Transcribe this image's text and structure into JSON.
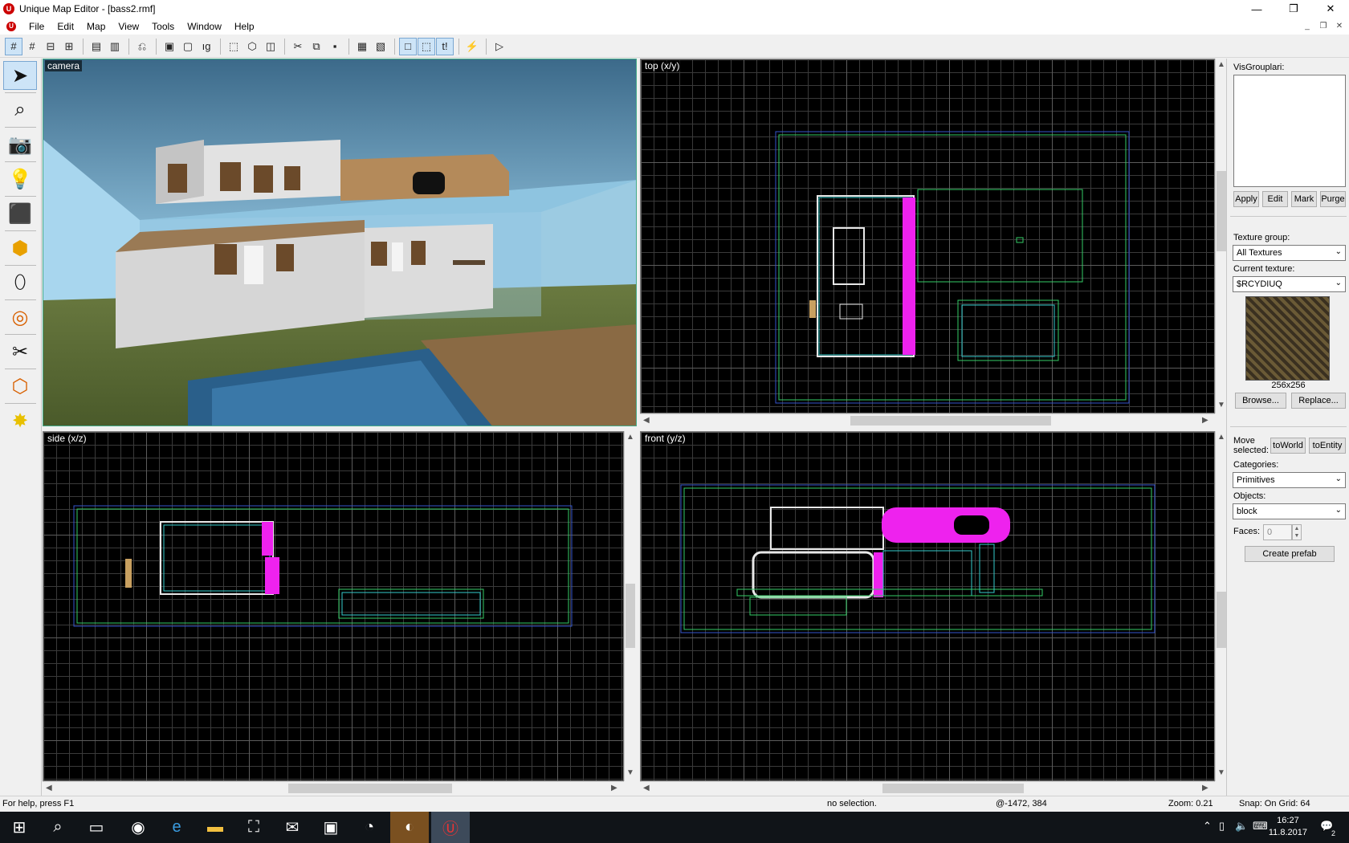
{
  "window": {
    "title": "Unique Map Editor - [bass2.rmf]",
    "minimize": "—",
    "maximize": "❐",
    "close": "✕"
  },
  "menu": [
    {
      "label": "File"
    },
    {
      "label": "Edit"
    },
    {
      "label": "Map"
    },
    {
      "label": "View"
    },
    {
      "label": "Tools"
    },
    {
      "label": "Window"
    },
    {
      "label": "Help"
    }
  ],
  "viewports": {
    "camera": "camera",
    "top": "top (x/y)",
    "side": "side (x/z)",
    "front": "front (y/z)"
  },
  "visgroups": {
    "title": "VisGrouplari:",
    "apply": "Apply",
    "edit": "Edit",
    "mark": "Mark",
    "purge": "Purge"
  },
  "texture": {
    "group_label": "Texture group:",
    "group_value": "All Textures",
    "current_label": "Current texture:",
    "current_value": "$RCYDIUQ",
    "size": "256x256",
    "browse": "Browse...",
    "replace": "Replace..."
  },
  "objects": {
    "move_selected": "Move selected:",
    "to_world": "toWorld",
    "to_entity": "toEntity",
    "categories_label": "Categories:",
    "categories_value": "Primitives",
    "objects_label": "Objects:",
    "objects_value": "block",
    "faces_label": "Faces:",
    "faces_value": "0",
    "create_prefab": "Create prefab"
  },
  "status": {
    "help": "For help, press F1",
    "selection": "no selection.",
    "coords": "@-1472, 384",
    "zoom": "Zoom: 0.21",
    "snap": "Snap: On Grid: 64"
  },
  "taskbar": {
    "time": "16:27",
    "date": "11.8.2017",
    "notifications": "2"
  },
  "colors": {
    "brush_cyan": "#33cccc",
    "brush_green": "#33cc66",
    "brush_blue": "#3355cc",
    "brush_magenta": "#ee22ee",
    "brush_white": "#e8e8e8"
  }
}
